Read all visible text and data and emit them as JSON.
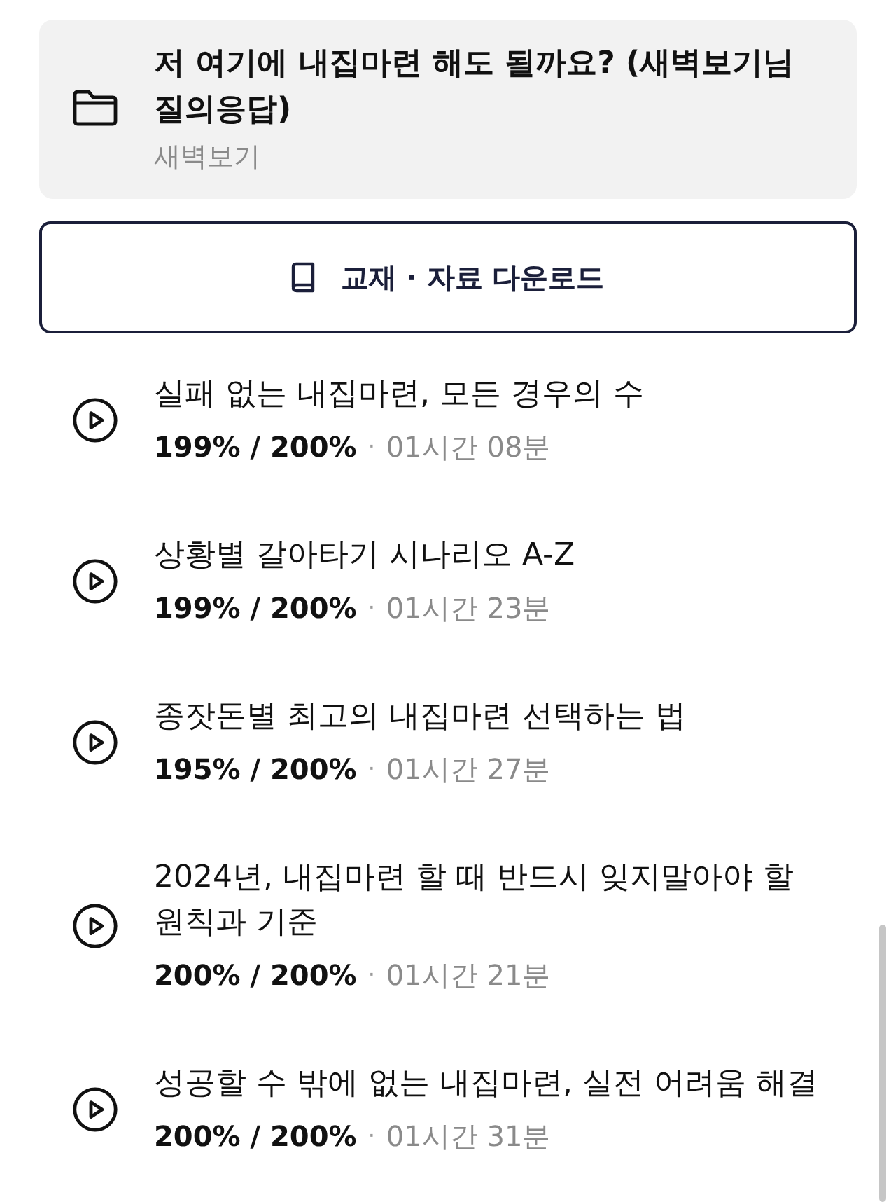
{
  "folder_card": {
    "title": "저 여기에 내집마련 해도 될까요? (새벽보기님 질의응답)",
    "subtitle": "새벽보기"
  },
  "download_button": {
    "label": "교재 · 자료 다운로드"
  },
  "lectures": [
    {
      "title": "실패 없는 내집마련, 모든 경우의 수",
      "progress": "199% / 200%",
      "separator": "·",
      "duration": "01시간 08분"
    },
    {
      "title": "상황별 갈아타기 시나리오 A-Z",
      "progress": "199% / 200%",
      "separator": "·",
      "duration": "01시간 23분"
    },
    {
      "title": "종잣돈별 최고의 내집마련 선택하는 법",
      "progress": "195% / 200%",
      "separator": "·",
      "duration": "01시간 27분"
    },
    {
      "title": "2024년, 내집마련 할 때 반드시 잊지말아야 할 원칙과 기준",
      "progress": "200% / 200%",
      "separator": "·",
      "duration": "01시간 21분"
    },
    {
      "title": "성공할 수 밖에 없는 내집마련, 실전 어려움 해결",
      "progress": "200% / 200%",
      "separator": "·",
      "duration": "01시간 31분"
    }
  ]
}
